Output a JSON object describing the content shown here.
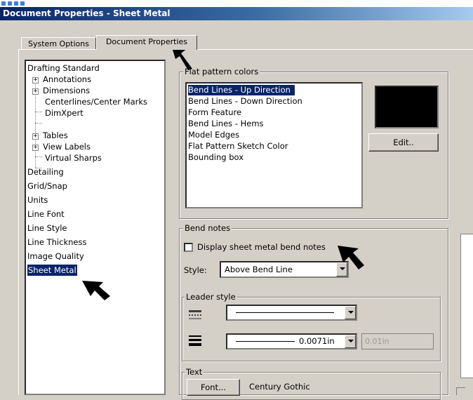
{
  "window": {
    "title": "Document Properties - Sheet Metal"
  },
  "tabs": [
    {
      "label": "System Options"
    },
    {
      "label": "Document Properties"
    }
  ],
  "tree": {
    "items": [
      {
        "label": "Drafting Standard"
      },
      {
        "label": "Annotations"
      },
      {
        "label": "Dimensions"
      },
      {
        "label": "Centerlines/Center Marks"
      },
      {
        "label": "DimXpert"
      },
      {
        "label": "Tables"
      },
      {
        "label": "View Labels"
      },
      {
        "label": "Virtual Sharps"
      },
      {
        "label": "Detailing"
      },
      {
        "label": "Grid/Snap"
      },
      {
        "label": "Units"
      },
      {
        "label": "Line Font"
      },
      {
        "label": "Line Style"
      },
      {
        "label": "Line Thickness"
      },
      {
        "label": "Image Quality"
      },
      {
        "label": "Sheet Metal"
      }
    ]
  },
  "flat_pattern": {
    "label": "Flat pattern colors",
    "items": [
      {
        "label": "Bend Lines - Up Direction"
      },
      {
        "label": "Bend Lines - Down Direction"
      },
      {
        "label": "Form Feature"
      },
      {
        "label": "Bend Lines - Hems"
      },
      {
        "label": "Model Edges"
      },
      {
        "label": "Flat Pattern Sketch Color"
      },
      {
        "label": "Bounding box"
      }
    ],
    "swatch_color": "#000000",
    "edit_label": "Edit.."
  },
  "bend_notes": {
    "label": "Bend notes",
    "display_checkbox_label": "Display sheet metal bend notes",
    "display_checked": false,
    "style_label": "Style:",
    "style_value": "Above Bend Line"
  },
  "leader_style": {
    "label": "Leader style",
    "thickness_value": "0.0071in",
    "custom_value": "0.01in"
  },
  "text": {
    "label": "Text",
    "font_button": "Font...",
    "font_name": "Century Gothic"
  },
  "colors": {
    "selection": "#0a246a",
    "dialog_bg": "#d4d0c8"
  }
}
